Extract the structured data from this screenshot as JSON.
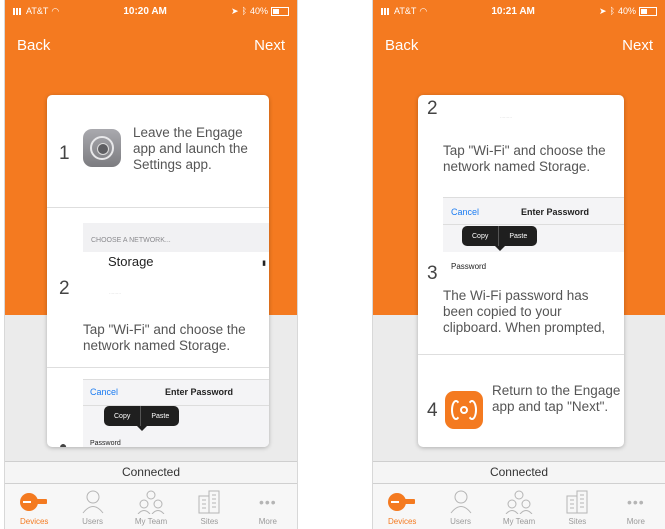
{
  "left": {
    "status": {
      "carrier": "AT&T",
      "time": "10:20 AM",
      "battery": "40%"
    },
    "nav": {
      "back": "Back",
      "next": "Next"
    },
    "steps": {
      "s1_num": "1",
      "s1_text": "Leave the Engage app and launch the Settings app.",
      "choose_network": "CHOOSE A NETWORK...",
      "network_name": "Storage",
      "s2_num": "2",
      "s2_text": "Tap \"Wi-Fi\" and choose the network named Storage.",
      "cancel": "Cancel",
      "enter_password": "Enter Password",
      "copy": "Copy",
      "paste": "Paste",
      "password": "Password"
    },
    "connected": "Connected"
  },
  "right": {
    "status": {
      "carrier": "AT&T",
      "time": "10:21 AM",
      "battery": "40%"
    },
    "nav": {
      "back": "Back",
      "next": "Next"
    },
    "steps": {
      "s2_num": "2",
      "s2_text": "Tap \"Wi-Fi\" and choose the network named Storage.",
      "cancel": "Cancel",
      "enter_password": "Enter Password",
      "copy": "Copy",
      "paste": "Paste",
      "s3_num": "3",
      "password": "Password",
      "s3_text": "The Wi-Fi password has been copied to your clipboard. When prompted,",
      "s4_num": "4",
      "s4_text": "Return to the Engage app and tap \"Next\"."
    },
    "connected": "Connected"
  },
  "tabs": [
    {
      "label": "Devices",
      "icon": "devices-icon",
      "active": true
    },
    {
      "label": "Users",
      "icon": "user-icon",
      "active": false
    },
    {
      "label": "My Team",
      "icon": "team-icon",
      "active": false
    },
    {
      "label": "Sites",
      "icon": "building-icon",
      "active": false
    },
    {
      "label": "More",
      "icon": "more-icon",
      "active": false
    }
  ],
  "colors": {
    "accent": "#f47a20",
    "link": "#1b7cf2"
  }
}
